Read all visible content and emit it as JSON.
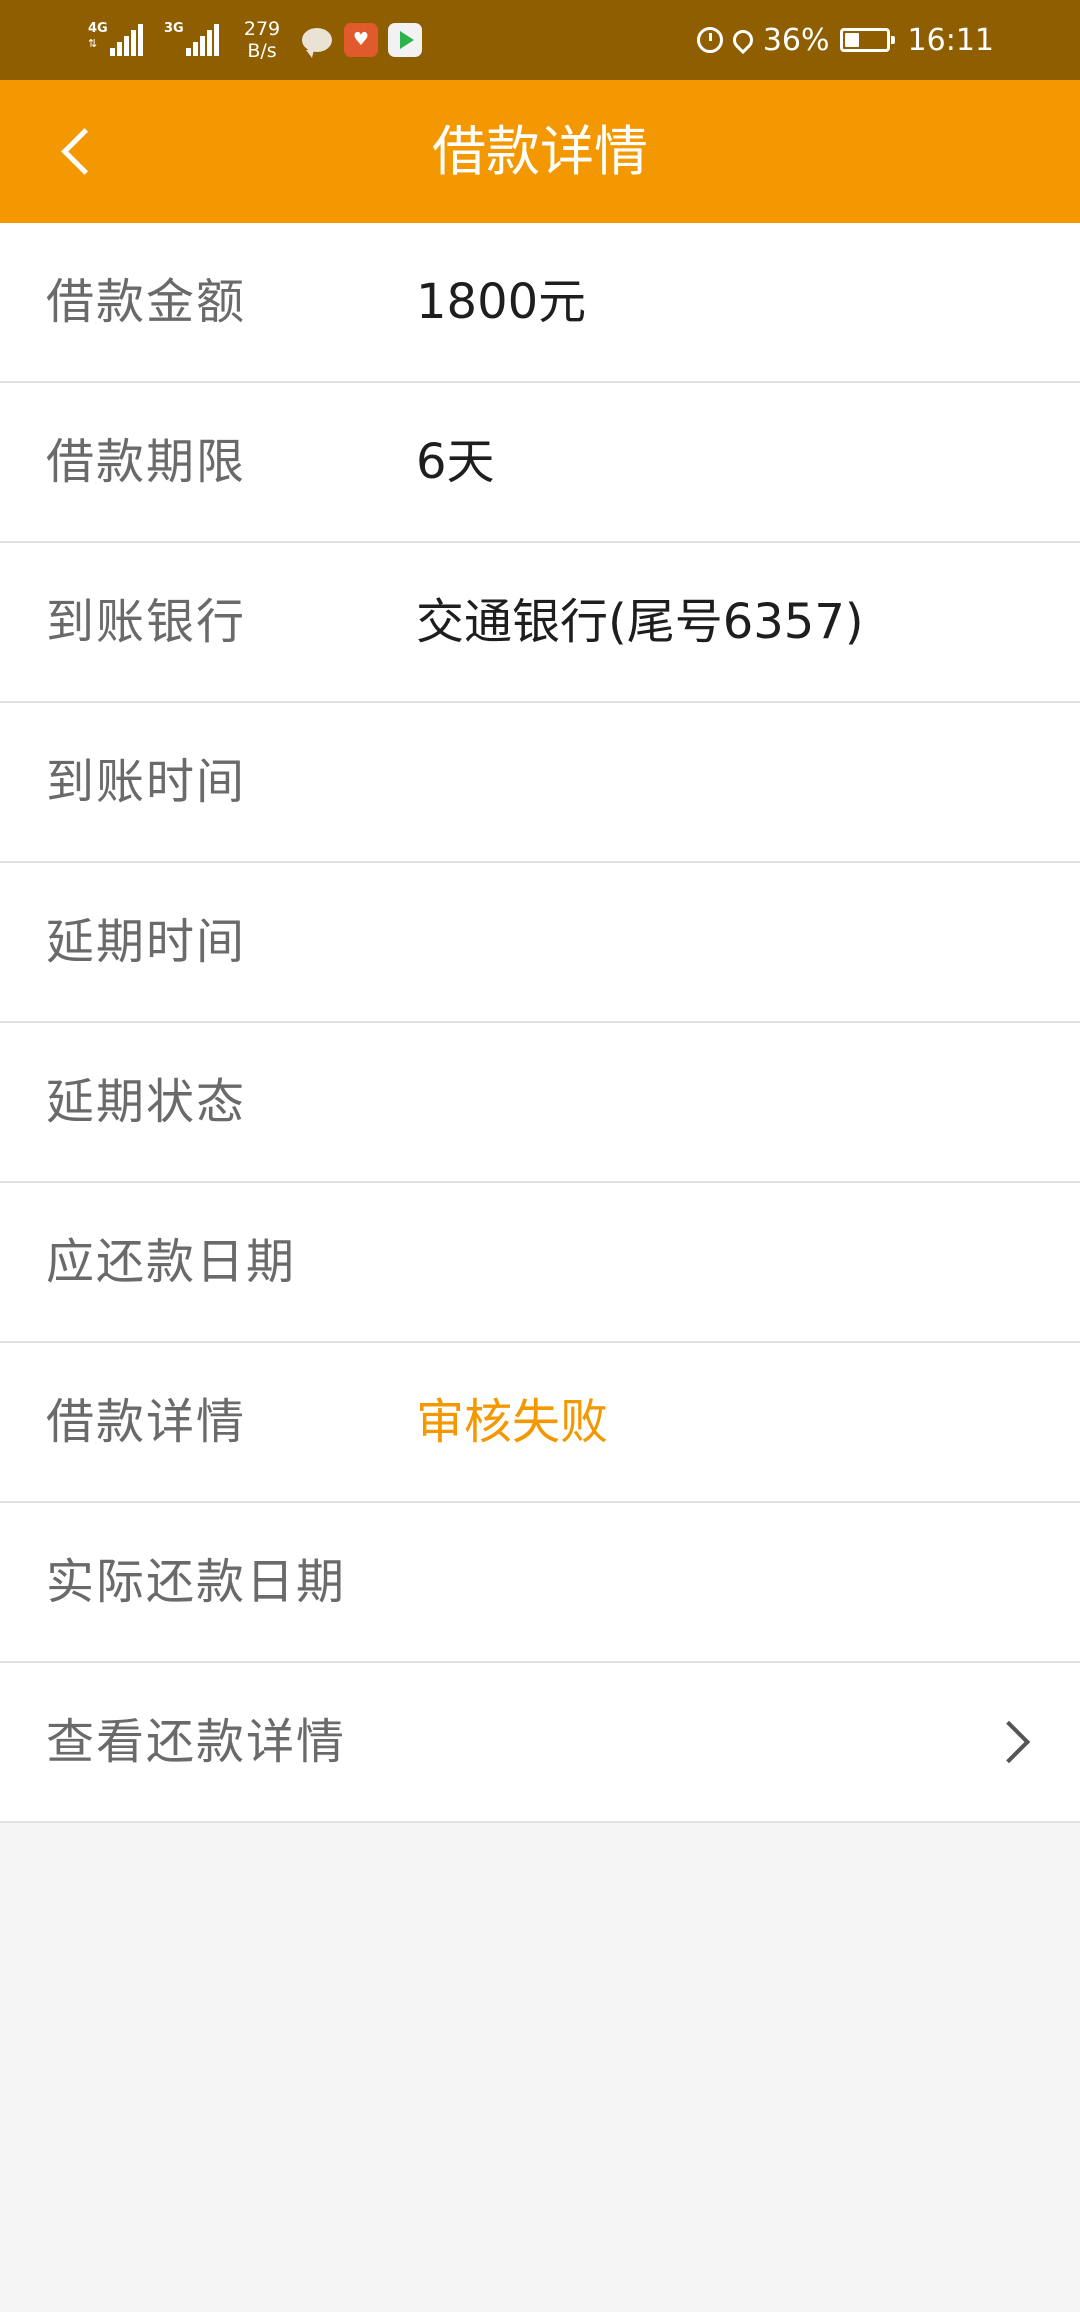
{
  "status_bar": {
    "network_1": "4G",
    "network_2": "3G",
    "speed_value": "279",
    "speed_unit": "B/s",
    "battery_pct": "36%",
    "time": "16:11"
  },
  "header": {
    "title": "借款详情"
  },
  "rows": [
    {
      "label": "借款金额",
      "value": "1800元"
    },
    {
      "label": "借款期限",
      "value": "6天"
    },
    {
      "label": "到账银行",
      "value": "交通银行(尾号6357)"
    },
    {
      "label": "到账时间",
      "value": ""
    },
    {
      "label": "延期时间",
      "value": ""
    },
    {
      "label": "延期状态",
      "value": ""
    },
    {
      "label": "应还款日期",
      "value": ""
    },
    {
      "label": "借款详情",
      "value": "审核失败"
    },
    {
      "label": "实际还款日期",
      "value": ""
    },
    {
      "label": "查看还款详情",
      "value": ""
    }
  ],
  "colors": {
    "accent": "#f39800",
    "status_bar": "#8f5e00",
    "background": "#f5f5f5"
  }
}
